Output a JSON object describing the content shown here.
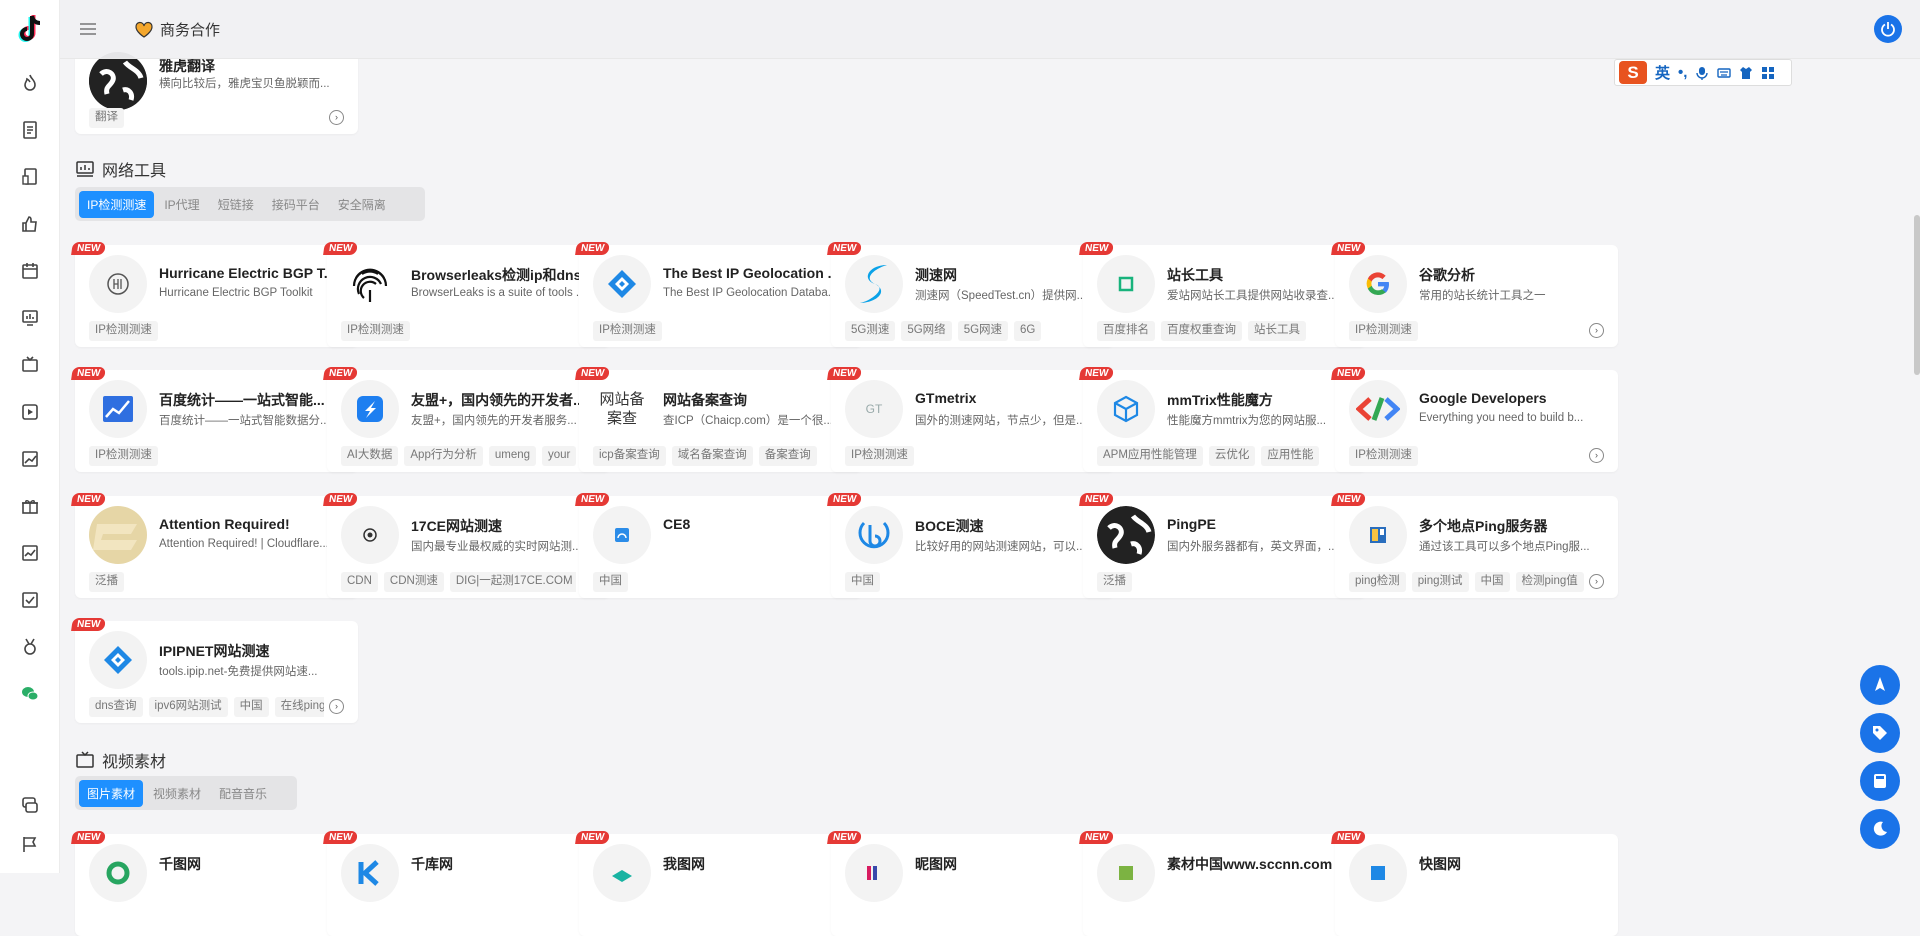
{
  "topbar": {
    "biz_label": "商务合作"
  },
  "ime": {
    "lang": "英",
    "punct": "•,"
  },
  "sections": {
    "network": {
      "title": "网络工具",
      "tabs": [
        "IP检测测速",
        "IP代理",
        "短链接",
        "接码平台",
        "安全隔离"
      ]
    },
    "video": {
      "title": "视频素材",
      "tabs": [
        "图片素材",
        "视频素材",
        "配音音乐"
      ]
    }
  },
  "new_badge": "NEW",
  "top_card": {
    "title": "雅虎翻译",
    "desc": "横向比较后，雅虎宝贝鱼脱颖而...",
    "tags": [
      "翻译"
    ]
  },
  "cards": [
    {
      "title": "Hurricane Electric BGP T...",
      "desc": "Hurricane Electric BGP Toolkit",
      "tags": [
        "IP检测测速"
      ],
      "icon": "he-icon"
    },
    {
      "title": "Browserleaks检测ip和dns",
      "desc": "BrowserLeaks is a suite of tools ...",
      "tags": [
        "IP检测测速"
      ],
      "icon": "fingerprint-icon"
    },
    {
      "title": "The Best IP Geolocation ...",
      "desc": "The Best IP Geolocation Databa...",
      "tags": [
        "IP检测测速"
      ],
      "icon": "ipip-icon"
    },
    {
      "title": "测速网",
      "desc": "测速网（SpeedTest.cn）提供网...",
      "tags": [
        "5G测速",
        "5G网络",
        "5G网速",
        "6G"
      ],
      "icon": "speedtest-icon"
    },
    {
      "title": "站长工具",
      "desc": "爱站网站长工具提供网站收录查...",
      "tags": [
        "百度排名",
        "百度权重查询",
        "站长工具"
      ],
      "icon": "chinaz-icon"
    },
    {
      "title": "谷歌分析",
      "desc": "常用的站长统计工具之一",
      "tags": [
        "IP检测测速"
      ],
      "icon": "google-icon"
    },
    {
      "title": "百度统计——一站式智能...",
      "desc": "百度统计——一站式智能数据分...",
      "tags": [
        "IP检测测速"
      ],
      "icon": "baidu-tongji-icon"
    },
    {
      "title": "友盟+，国内领先的开发者...",
      "desc": "友盟+，国内领先的开发者服务...",
      "tags": [
        "AI大数据",
        "App行为分析",
        "umeng",
        "your"
      ],
      "icon": "umeng-icon"
    },
    {
      "title": "网站备案查询",
      "desc": "查ICP（Chaicp.com）是一个很...",
      "tags": [
        "icp备案查询",
        "域名备案查询",
        "备案查询"
      ],
      "icon": "broken-image-icon",
      "icon_alt": "网站备案查"
    },
    {
      "title": "GTmetrix",
      "desc": "国外的测速网站，节点少，但是...",
      "tags": [
        "IP检测测速"
      ],
      "icon": "gtmetrix-icon"
    },
    {
      "title": "mmTrix性能魔方",
      "desc": "性能魔方mmtrix为您的网站服...",
      "tags": [
        "APM应用性能管理",
        "云优化",
        "应用性能"
      ],
      "icon": "cube-icon"
    },
    {
      "title": "Google Developers",
      "desc": "Everything you need to build b...",
      "tags": [
        "IP检测测速"
      ],
      "icon": "google-dev-icon"
    },
    {
      "title": "Attention Required!",
      "desc": "Attention Required! | Cloudflare...",
      "tags": [
        "泛播"
      ],
      "icon": "cloudflare-icon"
    },
    {
      "title": "17CE网站测速",
      "desc": "国内最专业最权威的实时网站测...",
      "tags": [
        "CDN",
        "CDN测速",
        "DIG|一起测17CE.COM"
      ],
      "icon": "eye-icon"
    },
    {
      "title": "CE8",
      "desc": "",
      "tags": [
        "中国"
      ],
      "icon": "ce8-icon"
    },
    {
      "title": "BOCE测速",
      "desc": "比较好用的网站测速网站，可以...",
      "tags": [
        "中国"
      ],
      "icon": "boce-icon"
    },
    {
      "title": "PingPE",
      "desc": "国内外服务器都有，英文界面，...",
      "tags": [
        "泛播"
      ],
      "icon": "globe-icon"
    },
    {
      "title": "多个地点Ping服务器",
      "desc": "通过该工具可以多个地点Ping服...",
      "tags": [
        "ping检测",
        "ping测试",
        "中国",
        "检测ping值"
      ],
      "icon": "ping-icon"
    },
    {
      "title": "IPIPNET网站测速",
      "desc": "tools.ipip.net-免费提供网站速...",
      "tags": [
        "dns查询",
        "ipv6网站测试",
        "中国",
        "在线ping"
      ],
      "icon": "ipip-icon"
    }
  ],
  "bottom_cards": [
    {
      "title": "千图网",
      "icon": "qiantu-icon"
    },
    {
      "title": "千库网",
      "icon": "qianku-icon"
    },
    {
      "title": "我图网",
      "icon": "wotu-icon"
    },
    {
      "title": "昵图网",
      "icon": "nipic-icon"
    },
    {
      "title": "素材中国www.sccnn.com",
      "icon": "sccnn-icon"
    },
    {
      "title": "快图网",
      "icon": "kuaitu-icon"
    }
  ],
  "colors": {
    "accent": "#1e90ff",
    "new_badge": "#e53935",
    "fab": "#1a73e8"
  }
}
